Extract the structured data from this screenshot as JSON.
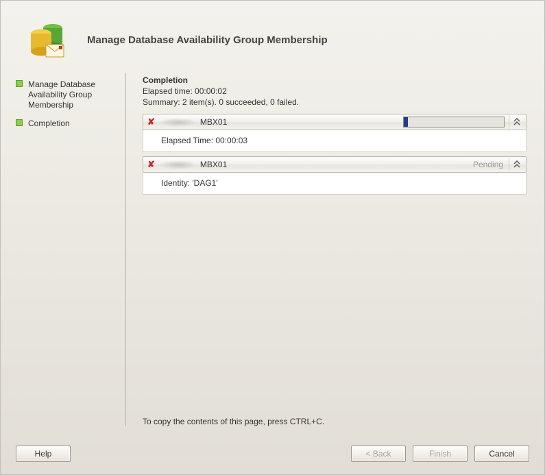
{
  "header": {
    "title": "Manage Database Availability Group Membership"
  },
  "sidebar": {
    "steps": [
      {
        "label": "Manage Database Availability Group Membership"
      },
      {
        "label": "Completion"
      }
    ]
  },
  "main": {
    "heading": "Completion",
    "elapsed_label": "Elapsed time: 00:00:02",
    "summary_label": "Summary: 2 item(s). 0 succeeded, 0 failed.",
    "items": [
      {
        "name": "MBX01",
        "status": "progress",
        "detail": "Elapsed Time: 00:00:03"
      },
      {
        "name": "MBX01",
        "status": "Pending",
        "detail": "Identity: 'DAG1'"
      }
    ],
    "copy_hint": "To copy the contents of this page, press CTRL+C."
  },
  "footer": {
    "help": "Help",
    "back": "< Back",
    "finish": "Finish",
    "cancel": "Cancel"
  }
}
